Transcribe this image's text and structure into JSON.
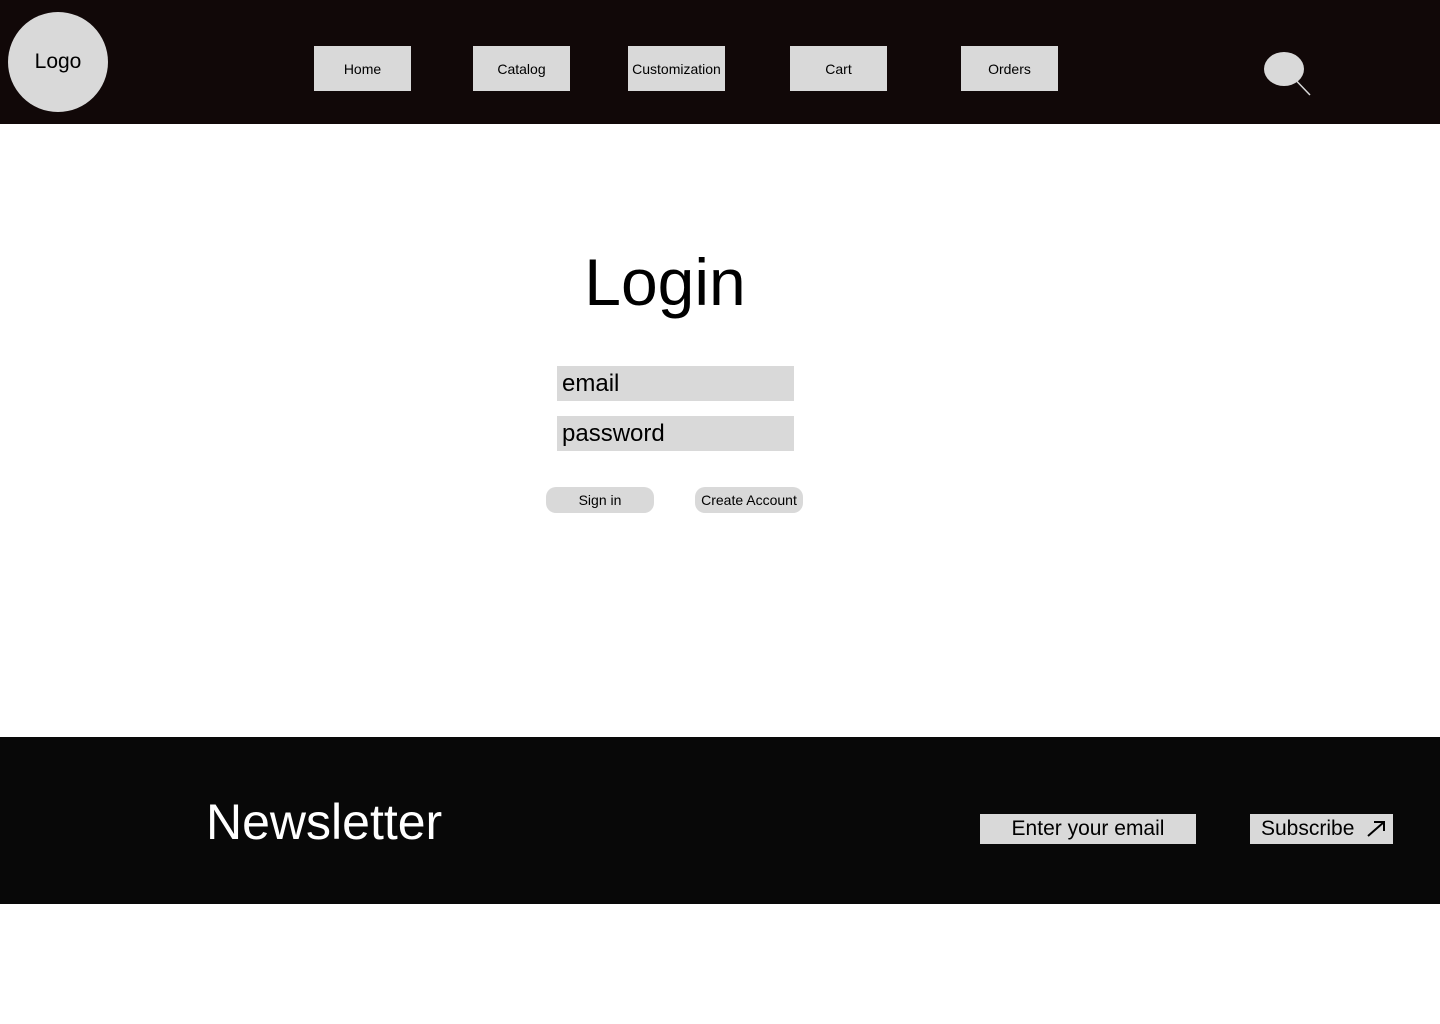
{
  "header": {
    "logo": "Logo",
    "nav": [
      {
        "label": "Home"
      },
      {
        "label": "Catalog"
      },
      {
        "label": "Customization"
      },
      {
        "label": "Cart"
      },
      {
        "label": "Orders"
      }
    ],
    "search_icon": "search-icon"
  },
  "login": {
    "title": "Login",
    "email_placeholder": "email",
    "password_placeholder": "password",
    "sign_in_label": "Sign in",
    "create_account_label": "Create Account"
  },
  "footer": {
    "newsletter_title": "Newsletter",
    "email_placeholder": "Enter your email",
    "subscribe_label": "Subscribe",
    "subscribe_icon": "arrow-up-right-icon"
  },
  "colors": {
    "header_bg": "#110808",
    "footer_bg": "#080808",
    "control_bg": "#d9d9d9"
  }
}
